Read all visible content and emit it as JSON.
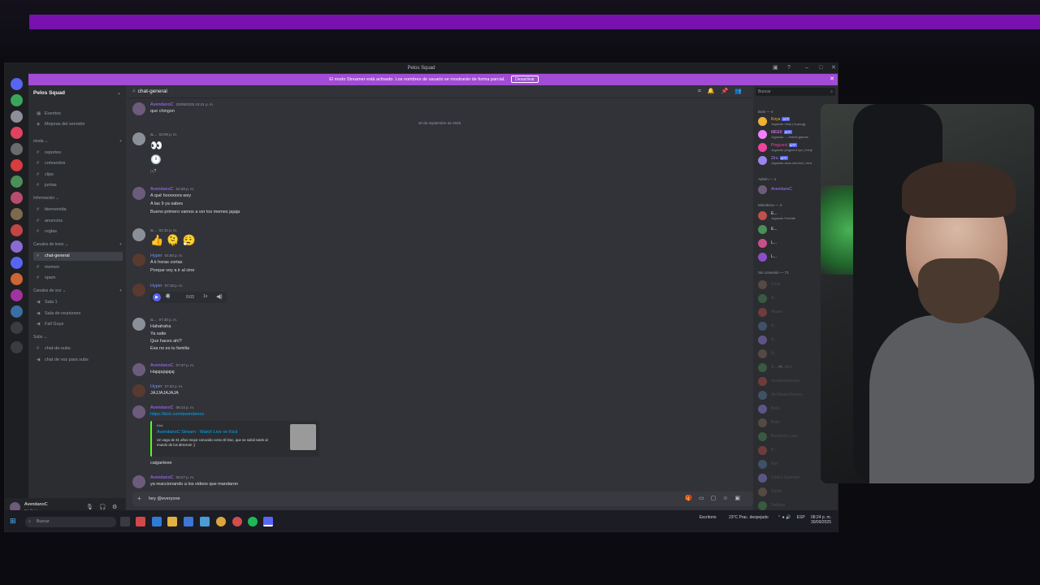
{
  "window": {
    "title": "Pelos Squad",
    "banner_text": "El modo Streamer está activado. Los nombres de usuario se mostrarán de forma parcial.",
    "banner_button": "Desactivar"
  },
  "guild": {
    "name": "Pelos Squad",
    "top_items": [
      {
        "label": "Eventos",
        "icon": "calendar-icon"
      },
      {
        "label": "Mejoras del servidor",
        "icon": "boost-icon"
      }
    ],
    "categories": [
      {
        "name": "moda",
        "channels": [
          "reportes",
          "comandos",
          "clips",
          "juntas"
        ]
      },
      {
        "name": "Información",
        "channels": [
          "bienvenida",
          "anuncios",
          "reglas"
        ]
      },
      {
        "name": "Canales de texto",
        "channels": [
          "chat-general",
          "memes",
          "spam"
        ]
      },
      {
        "name": "Canales de voz",
        "channels": [
          "Sala 1",
          "Sala de reuniones",
          "Fall Guys"
        ]
      },
      {
        "name": "Subs",
        "channels": [
          "chat-de-subs",
          "chat de voz para subs"
        ]
      }
    ],
    "active_channel": "chat-general"
  },
  "user": {
    "name": "AvendanoC",
    "status": "En línea"
  },
  "channel": {
    "name": "chat-general",
    "date_separator": "20 de septiembre de 2025",
    "input_value": "hey @everyone"
  },
  "messages": [
    {
      "author": "AvendanoC",
      "time": "20/09/2025 10:41 p. m.",
      "lines": [
        "que chingon"
      ],
      "color": "#a970ff"
    },
    {
      "author": "a...",
      "time": "03:09 p. m.",
      "lines": [
        "👀",
        "🕐",
        ";-;?"
      ],
      "color": "#949ba4"
    },
    {
      "author": "AvendanoC",
      "time": "04:28 p. m.",
      "lines": [
        "A qué hooooora wey",
        "A las 9 ya sabes",
        "Bueno primero vamos a ver los memes jajaja"
      ],
      "color": "#a970ff"
    },
    {
      "author": "a...",
      "time": "04:32 p. m.",
      "lines": [
        "👍 🫠 😮‍💨"
      ],
      "color": "#949ba4"
    },
    {
      "author": "Hyper",
      "time": "04:50 p. m.",
      "lines": [
        "A k horas cortas",
        "Porque voy a ir al cine"
      ],
      "color": "#7d8cf5"
    },
    {
      "author": "Hyper",
      "time": "07:18 p. m.",
      "lines": [
        "0:03"
      ],
      "color": "#7d8cf5"
    },
    {
      "author": "a...",
      "time": "07:30 p. m.",
      "lines": [
        "Hahahaha",
        "Ya salte",
        "Que haces ahí?",
        "Esa no es tu familia"
      ],
      "color": "#949ba4"
    },
    {
      "author": "AvendanoC",
      "time": "07:37 p. m.",
      "lines": [
        "Hajajajajajaj"
      ],
      "color": "#a970ff"
    },
    {
      "author": "Hyper",
      "time": "07:40 p. m.",
      "lines": [
        "JAJJAJAJAJA"
      ],
      "color": "#7d8cf5"
    },
    {
      "author": "AvendanoC",
      "time": "08:14 p. m.",
      "lines": [
        "https://kick.com/avendanoc"
      ],
      "color": "#a970ff"
    },
    {
      "author": "",
      "time": "",
      "lines": [
        "caiganleee"
      ],
      "color": "#949ba4"
    },
    {
      "author": "AvendanoC",
      "time": "08:27 p. m.",
      "lines": [
        "ya reaccionando a los videos que mandaron"
      ],
      "color": "#a970ff"
    }
  ],
  "embed": {
    "provider": "Kick",
    "title": "AvendanoC Stream - Watch Live on Kick",
    "description": "Un vago de 31 años mejor conocido como El Doc, que se subió tarde al mundo de los directos! ;)"
  },
  "members": {
    "search_placeholder": "Buscar",
    "groups": [
      {
        "label": "Bots — 4",
        "items": [
          {
            "name": "Koya",
            "status": "Jugando /help | koya.gg",
            "badge": "APP",
            "color": "#f0b232"
          },
          {
            "name": "MEE6",
            "status": "Jugando → /mee6 games",
            "badge": "APP",
            "color": "#f47fff"
          },
          {
            "name": "Pingcord",
            "status": "Jugando pingcord.xyz | !help",
            "badge": "APP",
            "color": "#eb459e"
          },
          {
            "name": "Zira",
            "status": "Jugando docs.zira.bot | /zira",
            "badge": "APP",
            "color": "#9b84ee"
          }
        ]
      },
      {
        "label": "Admin — 1",
        "items": [
          {
            "name": "AvendanoC",
            "status": "",
            "badge": "",
            "color": "#a970ff"
          }
        ]
      },
      {
        "label": "Miembros — 4",
        "items": [
          {
            "name": "E...",
            "status": "Jugando Fortnite",
            "badge": "",
            "color": "#dbdee1"
          },
          {
            "name": "E...",
            "status": "",
            "badge": "",
            "color": "#dbdee1"
          },
          {
            "name": "L...",
            "status": "",
            "badge": "",
            "color": "#dbdee1"
          },
          {
            "name": "L...",
            "status": "",
            "badge": "",
            "color": "#dbdee1"
          }
        ]
      },
      {
        "label": "Sin conexión — 71",
        "items": [
          {
            "name": "Cristi",
            "status": "",
            "badge": "",
            "color": "#6d6f78"
          },
          {
            "name": "A...",
            "status": "",
            "badge": "",
            "color": "#6d6f78"
          },
          {
            "name": "Akane",
            "status": "",
            "badge": "",
            "color": "#6d6f78"
          },
          {
            "name": "A...",
            "status": "",
            "badge": "",
            "color": "#6d6f78"
          },
          {
            "name": "A...",
            "status": "",
            "badge": "",
            "color": "#6d6f78"
          },
          {
            "name": "A...",
            "status": "",
            "badge": "",
            "color": "#6d6f78"
          },
          {
            "name": "A... 🎮 libre",
            "status": "",
            "badge": "",
            "color": "#6d6f78"
          },
          {
            "name": "arcaneshadows",
            "status": "",
            "badge": "",
            "color": "#6d6f78"
          },
          {
            "name": "ArcMasterGames",
            "status": "",
            "badge": "",
            "color": "#6d6f78"
          },
          {
            "name": "Bello",
            "status": "",
            "badge": "",
            "color": "#6d6f78"
          },
          {
            "name": "Bello",
            "status": "",
            "badge": "",
            "color": "#6d6f78"
          },
          {
            "name": "Bernardo Lara",
            "status": "",
            "badge": "",
            "color": "#6d6f78"
          },
          {
            "name": "B...",
            "status": "",
            "badge": "",
            "color": "#6d6f78"
          },
          {
            "name": "Bori",
            "status": "",
            "badge": "",
            "color": "#6d6f78"
          },
          {
            "name": "Carlos Guzmán",
            "status": "",
            "badge": "",
            "color": "#6d6f78"
          },
          {
            "name": "David",
            "status": "",
            "badge": "",
            "color": "#6d6f78"
          },
          {
            "name": "Debbye",
            "status": "",
            "badge": "",
            "color": "#6d6f78"
          }
        ]
      }
    ]
  },
  "taskbar": {
    "search_placeholder": "Buscar",
    "desktop_label": "Escritorio",
    "weather": "23°C Prac. despejado",
    "lang": "ESP",
    "time": "08:24 p. m.",
    "date": "30/09/2025"
  }
}
